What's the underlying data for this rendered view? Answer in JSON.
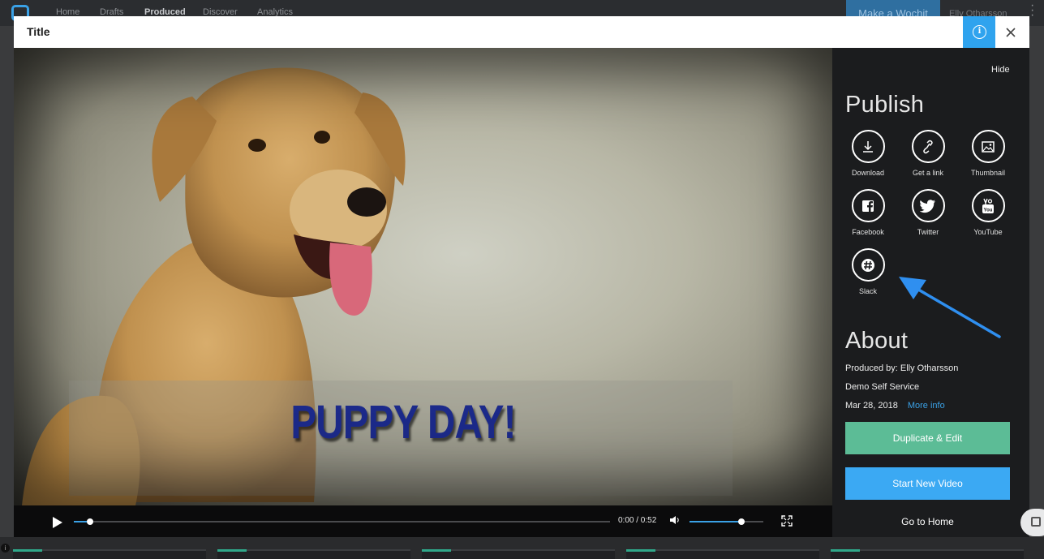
{
  "app_nav": {
    "items": [
      {
        "label": "Home",
        "active": false
      },
      {
        "label": "Drafts",
        "active": false
      },
      {
        "label": "Produced",
        "active": true
      },
      {
        "label": "Discover",
        "active": false
      },
      {
        "label": "Analytics",
        "active": false
      }
    ],
    "make_button": "Make a Wochit",
    "user_name": "Elly Otharsson"
  },
  "modal": {
    "title": "Title",
    "info_icon": "info-icon",
    "close_icon": "close-icon"
  },
  "video": {
    "caption": "PUPPY DAY!",
    "time_display": "0:00 / 0:52",
    "seek_progress": 0.015,
    "volume_level": 0.7
  },
  "panel": {
    "hide_label": "Hide",
    "publish_title": "Publish",
    "publish_items": [
      {
        "label": "Download",
        "icon": "download-icon"
      },
      {
        "label": "Get a link",
        "icon": "link-icon"
      },
      {
        "label": "Thumbnail",
        "icon": "image-icon"
      },
      {
        "label": "Facebook",
        "icon": "facebook-icon"
      },
      {
        "label": "Twitter",
        "icon": "twitter-icon"
      },
      {
        "label": "YouTube",
        "icon": "youtube-icon"
      },
      {
        "label": "Slack",
        "icon": "slack-icon"
      }
    ],
    "about_title": "About",
    "produced_by": "Produced by: Elly Otharsson",
    "organization": "Demo Self Service",
    "date": "Mar 28, 2018",
    "more_info": "More info",
    "duplicate_button": "Duplicate & Edit",
    "new_video_button": "Start New Video",
    "home_link": "Go to Home"
  },
  "colors": {
    "accent_blue": "#3aa1e6",
    "button_green": "#5cbc96",
    "button_blue": "#3ba9f3",
    "caption_blue": "#1c2a8a"
  }
}
